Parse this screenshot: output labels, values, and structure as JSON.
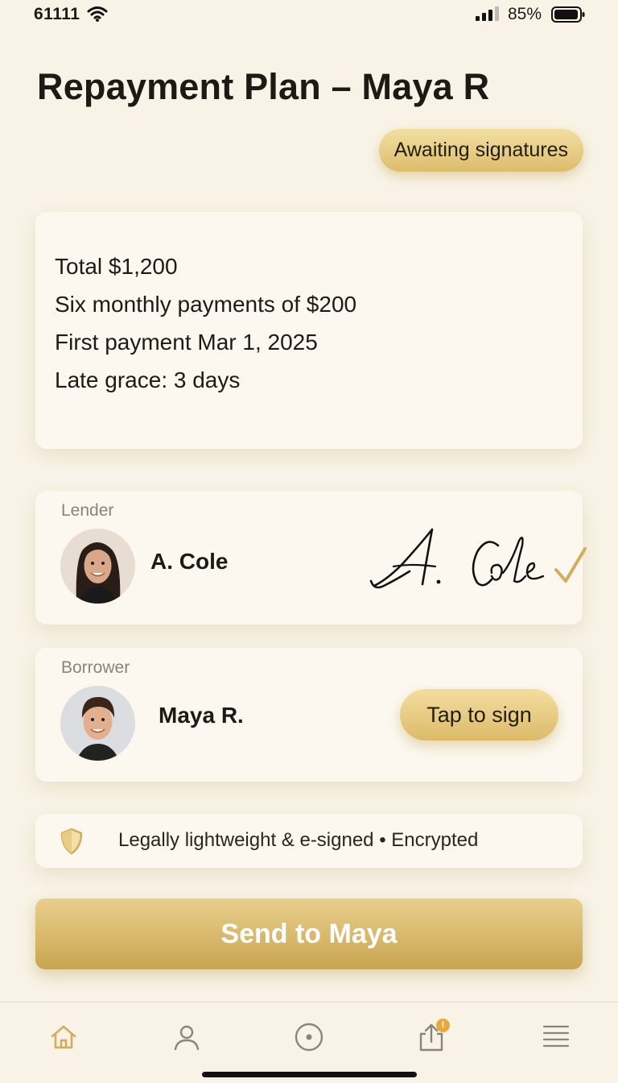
{
  "status_bar": {
    "time": "61111",
    "battery_percent": "85%",
    "icons": [
      "wifi-icon",
      "cell-signal-icon",
      "battery-icon"
    ]
  },
  "header": {
    "title": "Repayment Plan – Maya R",
    "status_badge": "Awaiting signatures"
  },
  "terms": {
    "lines": [
      "Total $1,200",
      "Six monthly payments of $200",
      "First payment Mar 1, 2025",
      "Late grace: 3 days"
    ]
  },
  "lender": {
    "role": "Lender",
    "name": "A. Cole",
    "signed": true,
    "signature_text": "A. Cole"
  },
  "borrower": {
    "role": "Borrower",
    "name": "Maya R.",
    "signed": false,
    "sign_button": "Tap to sign"
  },
  "security": {
    "icon": "shield-icon",
    "text": "Legally lightweight & e-signed • Encrypted"
  },
  "cta": {
    "label": "Send to Maya"
  },
  "tab_bar": {
    "items": [
      "home-icon",
      "profile-icon",
      "record-icon",
      "share-icon",
      "menu-icon"
    ],
    "active": "home-icon",
    "share_badge": "!"
  },
  "colors": {
    "background": "#f8f3e6",
    "accent_gold": "#d6b466",
    "card": "#fcf8ef",
    "text": "#1d1a16"
  }
}
